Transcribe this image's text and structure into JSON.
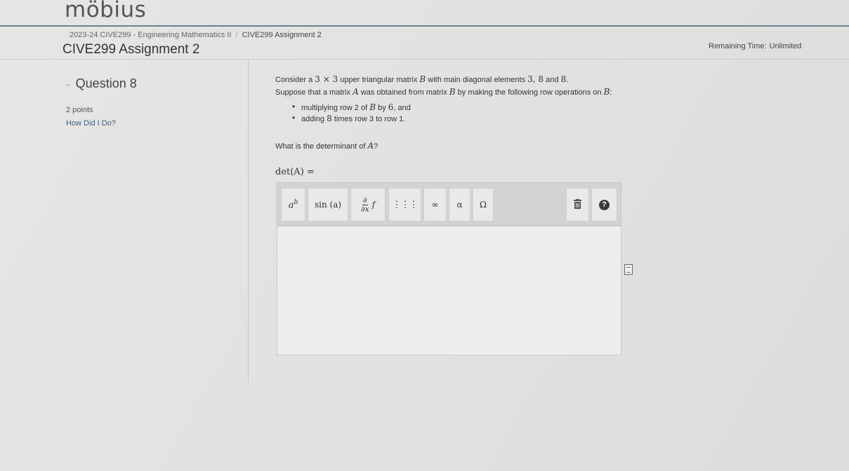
{
  "app": {
    "logo": "möbius"
  },
  "breadcrumb": {
    "course": "2023-24 CIVE299 - Engineering Mathematics II",
    "separator": "/",
    "current": "CIVE299 Assignment 2"
  },
  "page_title": "CIVE299 Assignment 2",
  "remaining_time": {
    "label": "Remaining Time:",
    "value": "Unlimited"
  },
  "question": {
    "collapse_marker": "-",
    "title": "Question 8",
    "points": "2 points",
    "how_did_i_do": "How Did I Do?",
    "line1": {
      "a": "Consider a",
      "dim": "3 × 3",
      "b": "upper triangular matrix",
      "matrix": "B",
      "c": "with main diagonal elements",
      "vals": "3, 8",
      "d": "and",
      "last": "8",
      "end": "."
    },
    "line2": {
      "a": "Suppose that a matrix",
      "matA": "A",
      "b": "was obtained from matrix",
      "matB": "B",
      "c": "by making the following row operations on",
      "matB2": "B",
      "end": ":"
    },
    "bullets": [
      {
        "a": "multiplying row 2 of",
        "mat": "B",
        "b": "by",
        "num": "6",
        "end": ", and"
      },
      {
        "a": "adding",
        "num": "8",
        "b": "times row 3 to row 1."
      }
    ],
    "prompt": {
      "a": "What is the determinant of",
      "mat": "A",
      "end": "?"
    },
    "answer_label": "det(A) ="
  },
  "toolbar": {
    "superscript": "ab",
    "sin": "sin (a)",
    "partial": "∂/∂x f",
    "matrix": "⋮⋮⋮",
    "infinity": "∞",
    "alpha": "α",
    "omega": "Ω",
    "trash": "🗑",
    "help": "?"
  },
  "colors": {
    "header_rule": "#6e7f91",
    "link": "#3f5d7a",
    "toolbar_bg": "#d3d3d1"
  }
}
